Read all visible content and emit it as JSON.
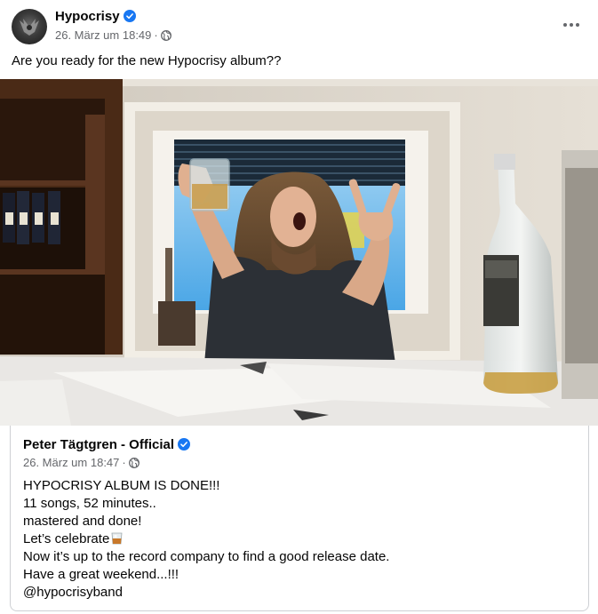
{
  "post": {
    "author": "Hypocrisy",
    "date": "26. März um 18:49",
    "separator": "·",
    "audience_icon": "globe-icon",
    "verified_icon": "verified-badge-icon",
    "text": "Are you ready for the new Hypocrisy album??"
  },
  "photo": {
    "subject": "photo"
  },
  "shared_post": {
    "author": "Peter Tägtgren - Official",
    "date": "26. März um 18:47",
    "separator": "·",
    "lines": [
      "HYPOCRISY ALBUM IS DONE!!!",
      "11 songs, 52 minutes..",
      "mastered and done!",
      "Let’s celebrate",
      "Now it’s up to the record company to find a good release date.",
      "Have a great weekend...!!!",
      "@hypocrisyband"
    ],
    "emoji_icon": "whisky-glass-icon"
  },
  "colors": {
    "text": "#050505",
    "secondary_text": "#65676b",
    "verified_blue": "#1877f2",
    "border": "#ced0d4"
  }
}
